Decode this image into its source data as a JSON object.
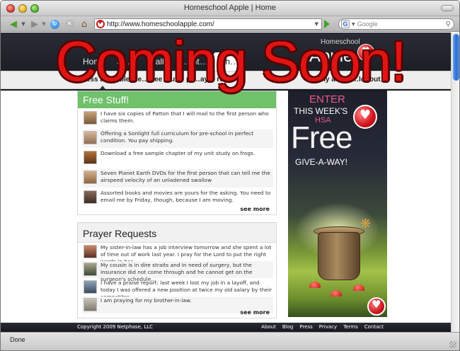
{
  "browser": {
    "window_title": "Homeschool Apple | Home",
    "url": "http://www.homeschoolapple.com/",
    "search_placeholder": "Google",
    "status": "Done"
  },
  "site": {
    "logo_small": "Homeschool",
    "logo_big": "Apple",
    "main_nav": [
      "Home",
      "Sh…",
      "…all…",
      "…nt…",
      "Rh…"
    ],
    "sub_nav": [
      "bless a…",
      "…blesse…",
      "free stuff",
      "pr…ayer reque…",
      "my accou…",
      "logout"
    ]
  },
  "free_stuff": {
    "title": "Free Stuff!",
    "items": [
      "I have six copies of Patton that I will mail to the first person who claims them.",
      "Offering a Sonlight full curriculum for pre-school in perfect condition. You pay shipping.",
      "Download a free sample chapter of my unit study on frogs.",
      "Seven Planet Earth DVDs for the first person that can tell me the airspeed velocity of an unladened swallow",
      "Assorted books and movies are yours for the asking. You need to email me by Friday, though, because I am moving."
    ],
    "see_more": "see more"
  },
  "prayer_requests": {
    "title": "Prayer Requests",
    "items": [
      "My sister-in-law has a job interview tomorrow and she spent a lot of time out of work last year. I pray for the Lord to put the right words in her...",
      "My cousin is in dire straits and in need of surgery, but the insurance did not come through and he cannot get on the surgeon's schedule...",
      "I have a praise report: last week I lost my job in a layoff, and today I was offered a new position at twice my old salary by their competitor...",
      "I am praying for my brother-in-law."
    ],
    "see_more": "see more"
  },
  "ad": {
    "enter": "ENTER",
    "this_week": "THIS WEEK'S",
    "hsa": "HSA",
    "free": "Free",
    "give": "GIVE-A-WAY!"
  },
  "footer": {
    "copyright": "Copyright 2009 Netphase, LLC",
    "links": [
      "About",
      "Blog",
      "Press",
      "Privacy",
      "Terms",
      "Contact"
    ]
  },
  "overlay": {
    "text": "Coming Soon!",
    "color": "#e01414"
  },
  "colors": {
    "header_bg": "#1b1d24",
    "free_stuff_green": "#6fc16a",
    "accent_red": "#d1121b"
  },
  "icons": {
    "back": "back-arrow-icon",
    "forward": "forward-arrow-icon",
    "reload": "reload-icon",
    "stop": "stop-icon",
    "home": "home-icon",
    "go": "go-arrow-icon",
    "search_engine": "google-icon"
  }
}
